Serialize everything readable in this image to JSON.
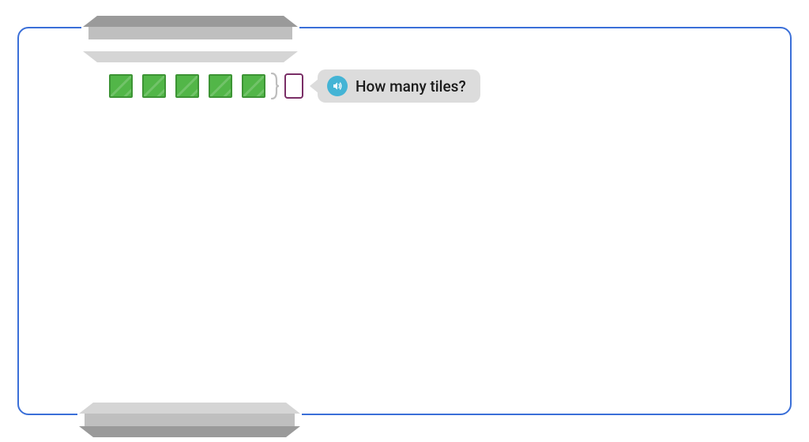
{
  "question": {
    "tile_count": 5,
    "prompt": "How many tiles?",
    "answer_value": ""
  },
  "colors": {
    "frame_border": "#3a6fd8",
    "tile_fill": "#52b648",
    "tile_border": "#3c9434",
    "answer_border": "#7a2e66",
    "bubble_bg": "#dcdcdc",
    "speaker_bg": "#44b4d5"
  },
  "icons": {
    "speaker": "speaker-icon"
  }
}
